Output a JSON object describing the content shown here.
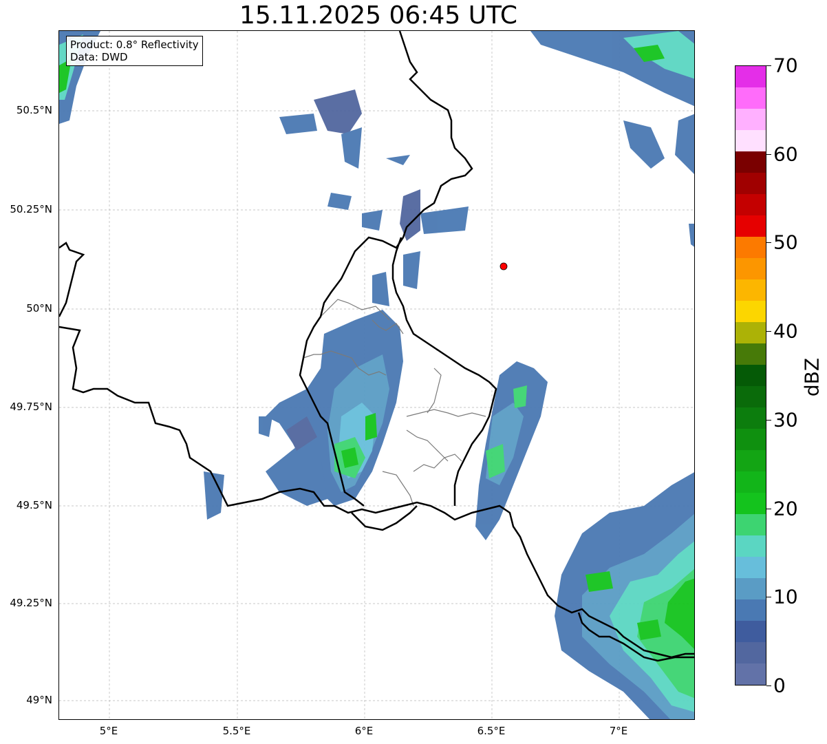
{
  "title": "15.11.2025 06:45 UTC",
  "info": {
    "product": "Product: 0.8° Reflectivity",
    "source": "Data: DWD"
  },
  "lat_labels": [
    "50.5°N",
    "50.25°N",
    "50°N",
    "49.75°N",
    "49.5°N",
    "49.25°N",
    "49°N"
  ],
  "lon_labels": [
    "5°E",
    "5.5°E",
    "6°E",
    "6.5°E",
    "7°E"
  ],
  "colorbar": {
    "label": "dBZ",
    "tick_labels": [
      "0",
      "10",
      "20",
      "30",
      "40",
      "50",
      "60",
      "70"
    ],
    "colors": [
      "#6272a8",
      "#52679f",
      "#3f5c9e",
      "#4a79b3",
      "#5a9cc5",
      "#67bedb",
      "#5bd6c2",
      "#3dd471",
      "#14c31d",
      "#12b519",
      "#13a514",
      "#0f900f",
      "#0c7d0d",
      "#0a6b0a",
      "#055a06",
      "#477a08",
      "#acb206",
      "#fcd600",
      "#fcb600",
      "#fc9600",
      "#fc7a00",
      "#e60000",
      "#c40000",
      "#a00000",
      "#7a0000",
      "#ffe0ff",
      "#ffb0ff",
      "#ff6cfa",
      "#e42ee8"
    ],
    "min": 0,
    "max": 70
  },
  "radar_site": {
    "lon": 6.547,
    "lat": 50.111,
    "color": "#ff0000"
  }
}
